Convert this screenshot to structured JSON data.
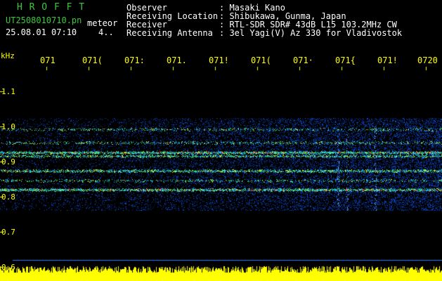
{
  "header": {
    "brand": "H R O F F T",
    "filename": "UT2508010710.pn",
    "meteor_label": "meteor",
    "timestamp": "25.08.01 07:10",
    "count": "4..",
    "info": [
      {
        "label": "Observer",
        "value": ": Masaki Kano"
      },
      {
        "label": "Receiving Location",
        "value": ": Shibukawa, Gunma, Japan"
      },
      {
        "label": "Receiver",
        "value": ": RTL-SDR SDR# 43dB L15 103.2MHz CW"
      },
      {
        "label": "Receiving Antenna",
        "value": ": 3el Yagi(V) Az 330 for Vladivostok"
      }
    ]
  },
  "axis": {
    "unit": "kHz",
    "time_ticks": [
      "071",
      "071(",
      "071:",
      "071.",
      "071!",
      "071(",
      "071·",
      "071{",
      "071!",
      "0720"
    ],
    "freq_ticks": [
      "1.1",
      "1.0",
      "0.9",
      "0.8",
      "0.7",
      "0.6"
    ]
  },
  "colors": {
    "background": "#000000",
    "noise": "#1f3fff",
    "signal_mid": "#00e0ff",
    "signal_hot": "#ff2020",
    "axis": "#ffff00",
    "brand": "#3ec83e"
  }
}
